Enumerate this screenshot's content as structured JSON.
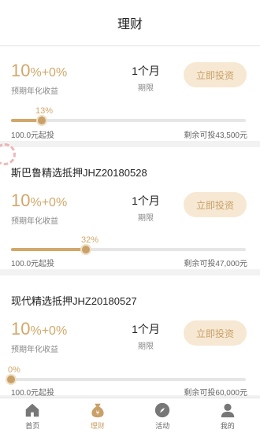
{
  "header": {
    "title": "理财"
  },
  "products": [
    {
      "name": "",
      "rate_base": "10",
      "rate_extra": "%+0%",
      "rate_label": "预期年化收益",
      "term": "1个月",
      "term_label": "期限",
      "button": "立即投资",
      "progress": 13,
      "progress_text": "13%",
      "min_text": "100.0元起投",
      "remain_text": "剩余可投43,500元"
    },
    {
      "name": "斯巴鲁精选抵押JHZ20180528",
      "rate_base": "10",
      "rate_extra": "%+0%",
      "rate_label": "预期年化收益",
      "term": "1个月",
      "term_label": "期限",
      "button": "立即投资",
      "progress": 32,
      "progress_text": "32%",
      "min_text": "100.0元起投",
      "remain_text": "剩余可投47,000元"
    },
    {
      "name": "现代精选抵押JHZ20180527",
      "rate_base": "10",
      "rate_extra": "%+0%",
      "rate_label": "预期年化收益",
      "term": "1个月",
      "term_label": "期限",
      "button": "立即投资",
      "progress": 0,
      "progress_text": "0%",
      "min_text": "100.0元起投",
      "remain_text": "剩余可投60,000元"
    }
  ],
  "tabbar": [
    {
      "label": "首页",
      "icon": "home-icon",
      "active": false
    },
    {
      "label": "理财",
      "icon": "money-bag-icon",
      "active": true
    },
    {
      "label": "活动",
      "icon": "compass-icon",
      "active": false
    },
    {
      "label": "我的",
      "icon": "user-icon",
      "active": false
    }
  ],
  "colors": {
    "accent": "#d2a76a",
    "button_bg": "#f6e8d3",
    "track": "#e6e6e6"
  }
}
